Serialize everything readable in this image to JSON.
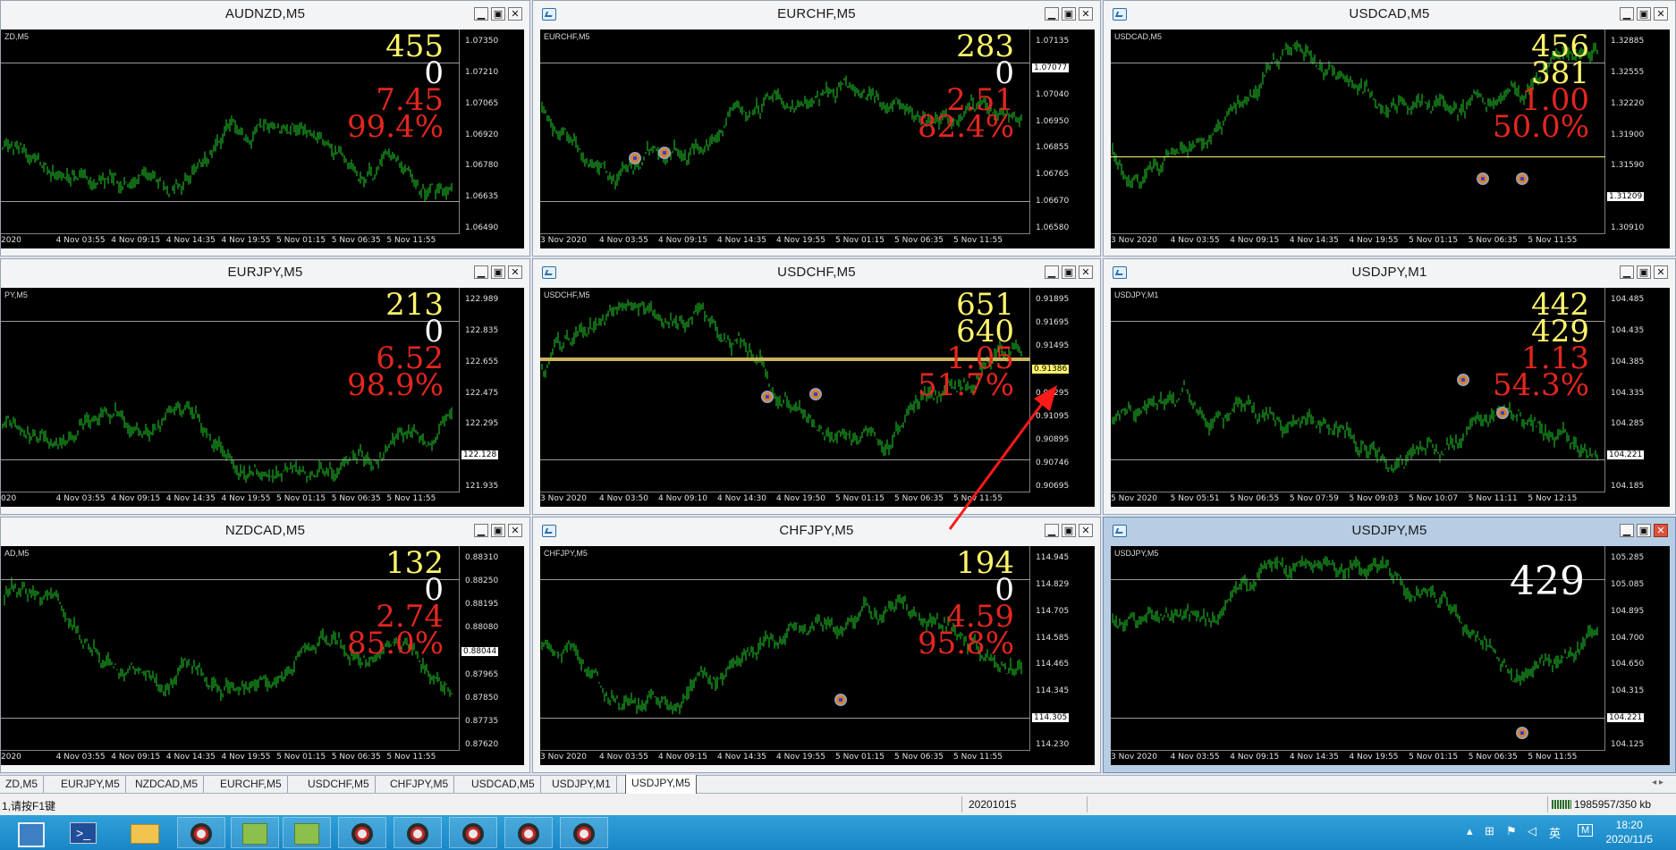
{
  "colors": {
    "candle": "#22d22a",
    "accent_red": "#e3261f",
    "accent_yellow": "#fff56b"
  },
  "windows": [
    {
      "title": "AUDNZD,M5",
      "sym": "ZD,M5",
      "nums": [
        [
          "455",
          "y"
        ],
        [
          "0",
          "w"
        ],
        [
          "7.45",
          "r"
        ],
        [
          "99.4%",
          "r"
        ]
      ],
      "prices": [
        "1.07350",
        "1.07210",
        "1.07065",
        "1.06920",
        "1.06780",
        "1.06635",
        "1.06490"
      ],
      "bid": "1.07232",
      "times": [
        "2020",
        "4 Nov 03:55",
        "4 Nov 09:15",
        "4 Nov 14:35",
        "4 Nov 19:55",
        "5 Nov 01:15",
        "5 Nov 06:35",
        "5 Nov 11:55"
      ]
    },
    {
      "title": "EURCHF,M5",
      "sym": "EURCHF,M5",
      "nums": [
        [
          "283",
          "y"
        ],
        [
          "0",
          "w"
        ],
        [
          "2.51",
          "r"
        ],
        [
          "82.4%",
          "r"
        ]
      ],
      "prices": [
        "1.07135",
        "1.07077",
        "1.07040",
        "1.06950",
        "1.06855",
        "1.06765",
        "1.06670",
        "1.06580"
      ],
      "bid": "1.07077",
      "times": [
        "3 Nov 2020",
        "4 Nov 03:55",
        "4 Nov 09:15",
        "4 Nov 14:35",
        "4 Nov 19:55",
        "5 Nov 01:15",
        "5 Nov 06:35",
        "5 Nov 11:55"
      ]
    },
    {
      "title": "USDCAD,M5",
      "sym": "USDCAD,M5",
      "nums": [
        [
          "456",
          "y"
        ],
        [
          "381",
          "y"
        ],
        [
          "1.00",
          "r"
        ],
        [
          "50.0%",
          "r"
        ]
      ],
      "prices": [
        "1.32885",
        "1.32555",
        "1.32220",
        "1.31900",
        "1.31590",
        "1.31209",
        "1.30910"
      ],
      "bid": "1.31209",
      "times": [
        "3 Nov 2020",
        "4 Nov 03:55",
        "4 Nov 09:15",
        "4 Nov 14:35",
        "4 Nov 19:55",
        "5 Nov 01:15",
        "5 Nov 06:35",
        "5 Nov 11:55"
      ]
    },
    {
      "title": "EURJPY,M5",
      "sym": "PY,M5",
      "nums": [
        [
          "213",
          "y"
        ],
        [
          "0",
          "w"
        ],
        [
          "6.52",
          "r"
        ],
        [
          "98.9%",
          "r"
        ]
      ],
      "prices": [
        "122.989",
        "122.835",
        "122.655",
        "122.475",
        "122.295",
        "122.128",
        "121.935"
      ],
      "bid": "122.128",
      "times": [
        "020",
        "4 Nov 03:55",
        "4 Nov 09:15",
        "4 Nov 14:35",
        "4 Nov 19:55",
        "5 Nov 01:15",
        "5 Nov 06:35",
        "5 Nov 11:55"
      ]
    },
    {
      "title": "USDCHF,M5",
      "sym": "USDCHF,M5",
      "nums": [
        [
          "651",
          "y"
        ],
        [
          "640",
          "y"
        ],
        [
          "1.05",
          "r"
        ],
        [
          "51.7%",
          "r"
        ]
      ],
      "prices": [
        "0.91895",
        "0.91695",
        "0.91495",
        "0.91386",
        "0.91295",
        "0.91095",
        "0.90895",
        "0.90746",
        "0.90695"
      ],
      "bid": "0.91386",
      "times": [
        "3 Nov 2020",
        "4 Nov 03:50",
        "4 Nov 09:10",
        "4 Nov 14:30",
        "4 Nov 19:50",
        "5 Nov 01:15",
        "5 Nov 06:35",
        "5 Nov 11:55"
      ]
    },
    {
      "title": "USDJPY,M1",
      "sym": "USDJPY,M1",
      "nums": [
        [
          "442",
          "y"
        ],
        [
          "429",
          "y"
        ],
        [
          "1.13",
          "r"
        ],
        [
          "54.3%",
          "r"
        ]
      ],
      "prices": [
        "104.485",
        "104.435",
        "104.385",
        "104.335",
        "104.285",
        "104.221",
        "104.185"
      ],
      "bid": "104.221",
      "times": [
        "5 Nov 2020",
        "5 Nov 05:51",
        "5 Nov 06:55",
        "5 Nov 07:59",
        "5 Nov 09:03",
        "5 Nov 10:07",
        "5 Nov 11:11",
        "5 Nov 12:15"
      ]
    },
    {
      "title": "NZDCAD,M5",
      "sym": "AD,M5",
      "nums": [
        [
          "132",
          "y"
        ],
        [
          "0",
          "w"
        ],
        [
          "2.74",
          "r"
        ],
        [
          "85.0%",
          "r"
        ]
      ],
      "prices": [
        "0.88310",
        "0.88250",
        "0.88195",
        "0.88080",
        "0.88044",
        "0.87965",
        "0.87850",
        "0.87735",
        "0.87620"
      ],
      "bid": "0.88044",
      "times": [
        "2020",
        "4 Nov 03:55",
        "4 Nov 09:15",
        "4 Nov 14:35",
        "4 Nov 19:55",
        "5 Nov 01:15",
        "5 Nov 06:35",
        "5 Nov 11:55"
      ]
    },
    {
      "title": "CHFJPY,M5",
      "sym": "CHFJPY,M5",
      "nums": [
        [
          "194",
          "y"
        ],
        [
          "0",
          "w"
        ],
        [
          "4.59",
          "r"
        ],
        [
          "95.8%",
          "r"
        ]
      ],
      "prices": [
        "114.945",
        "114.829",
        "114.705",
        "114.585",
        "114.465",
        "114.345",
        "114.305",
        "114.230"
      ],
      "bid": "114.305",
      "times": [
        "3 Nov 2020",
        "4 Nov 03:55",
        "4 Nov 09:15",
        "4 Nov 14:35",
        "4 Nov 19:55",
        "5 Nov 01:15",
        "5 Nov 06:35",
        "5 Nov 11:55"
      ]
    },
    {
      "title": "USDJPY,M5",
      "sym": "USDJPY,M5",
      "nums": [
        [
          "429",
          "w"
        ]
      ],
      "prices": [
        "105.285",
        "105.085",
        "104.895",
        "104.700",
        "104.650",
        "104.315",
        "104.221",
        "104.125"
      ],
      "bid": "104.221",
      "times": [
        "3 Nov 2020",
        "4 Nov 03:55",
        "4 Nov 09:15",
        "4 Nov 14:35",
        "4 Nov 19:55",
        "5 Nov 01:15",
        "5 Nov 06:35",
        "5 Nov 11:55"
      ]
    }
  ],
  "tabs": [
    "ZD,M5",
    "EURJPY,M5",
    "NZDCAD,M5",
    "EURCHF,M5",
    "USDCHF,M5",
    "CHFJPY,M5",
    "USDCAD,M5",
    "USDJPY,M1",
    "USDJPY,M5"
  ],
  "status": {
    "help": "1,请按F1键",
    "profile": "20201015",
    "traffic": "1985957/350 kb"
  },
  "taskbar": {
    "time": "18:20",
    "date": "2020/11/5",
    "ime": "英",
    "m_label": "M"
  }
}
